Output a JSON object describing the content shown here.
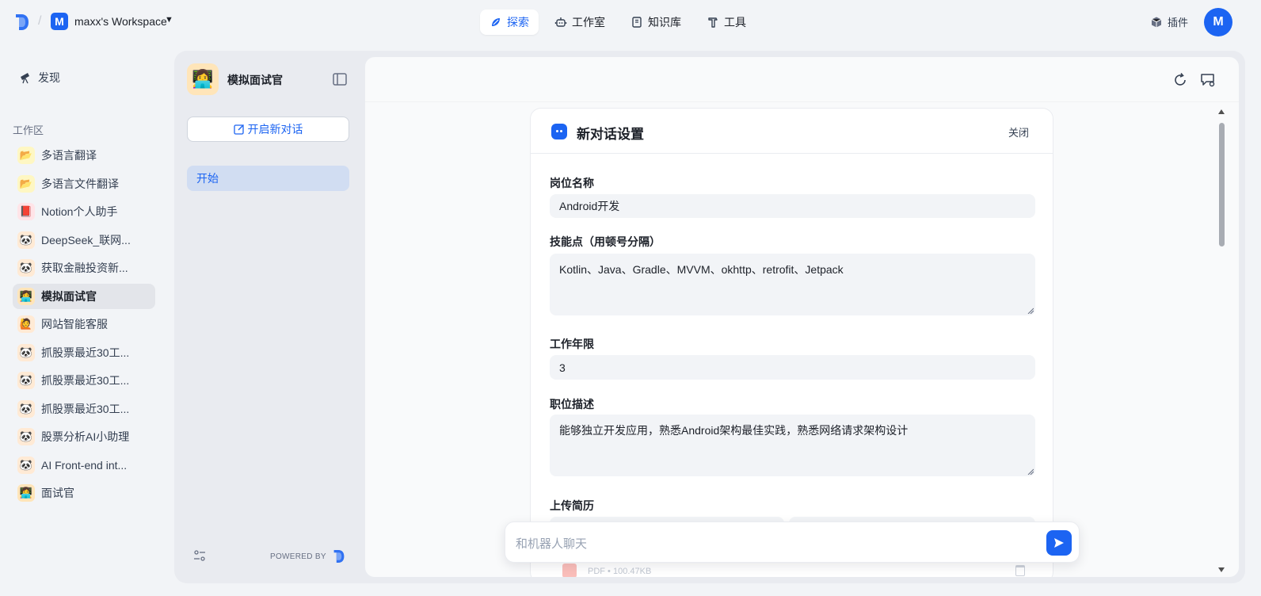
{
  "workspace": {
    "initial": "M",
    "name": "maxx's Workspace"
  },
  "nav": [
    {
      "label": "探索",
      "icon": "compass-icon",
      "active": true
    },
    {
      "label": "工作室",
      "icon": "robot-icon",
      "active": false
    },
    {
      "label": "知识库",
      "icon": "book-icon",
      "active": false
    },
    {
      "label": "工具",
      "icon": "hammer-icon",
      "active": false
    }
  ],
  "header": {
    "plugin_label": "插件",
    "user_initial": "M"
  },
  "sidebar": {
    "discover_label": "发现",
    "section_label": "工作区",
    "apps": [
      {
        "label": "多语言翻译",
        "emoji": "📂",
        "bg": "#fef7c3"
      },
      {
        "label": "多语言文件翻译",
        "emoji": "📂",
        "bg": "#fef7c3"
      },
      {
        "label": "Notion个人助手",
        "emoji": "📕",
        "bg": "#ffe4e8"
      },
      {
        "label": "DeepSeek_联网...",
        "emoji": "🐼",
        "bg": "#ffead5"
      },
      {
        "label": "获取金融投资新...",
        "emoji": "🐼",
        "bg": "#ffead5"
      },
      {
        "label": "模拟面试官",
        "emoji": "👩‍💻",
        "bg": "#ffe5b9",
        "active": true
      },
      {
        "label": "网站智能客服",
        "emoji": "🙋",
        "bg": "#ffead5"
      },
      {
        "label": "抓股票最近30工...",
        "emoji": "🐼",
        "bg": "#ffead5"
      },
      {
        "label": "抓股票最近30工...",
        "emoji": "🐼",
        "bg": "#ffead5"
      },
      {
        "label": "抓股票最近30工...",
        "emoji": "🐼",
        "bg": "#ffead5"
      },
      {
        "label": "股票分析AI小助理",
        "emoji": "🐼",
        "bg": "#ffead5"
      },
      {
        "label": "AI Front-end int...",
        "emoji": "🐼",
        "bg": "#ffead5"
      },
      {
        "label": "面试官",
        "emoji": "👩‍💻",
        "bg": "#ffe5b9"
      }
    ]
  },
  "bot": {
    "name": "模拟面试官",
    "avatar_emoji": "👩‍💻",
    "new_chat_label": "开启新对话",
    "conversation": "开始",
    "powered_by": "POWERED BY"
  },
  "form": {
    "title": "新对话设置",
    "close_label": "关闭",
    "fields": {
      "position_label": "岗位名称",
      "position_value": "Android开发",
      "skills_label": "技能点（用顿号分隔）",
      "skills_value": "Kotlin、Java、Gradle、MVVM、okhttp、retrofit、Jetpack",
      "years_label": "工作年限",
      "years_value": "3",
      "desc_label": "职位描述",
      "desc_value": "能够独立开发应用，熟悉Android架构最佳实践，熟悉网络请求架构设计",
      "upload_label": "上传简历",
      "file_meta": "PDF • 100.47KB"
    }
  },
  "chat": {
    "placeholder": "和机器人聊天"
  },
  "colors": {
    "accent": "#1c64f2"
  }
}
